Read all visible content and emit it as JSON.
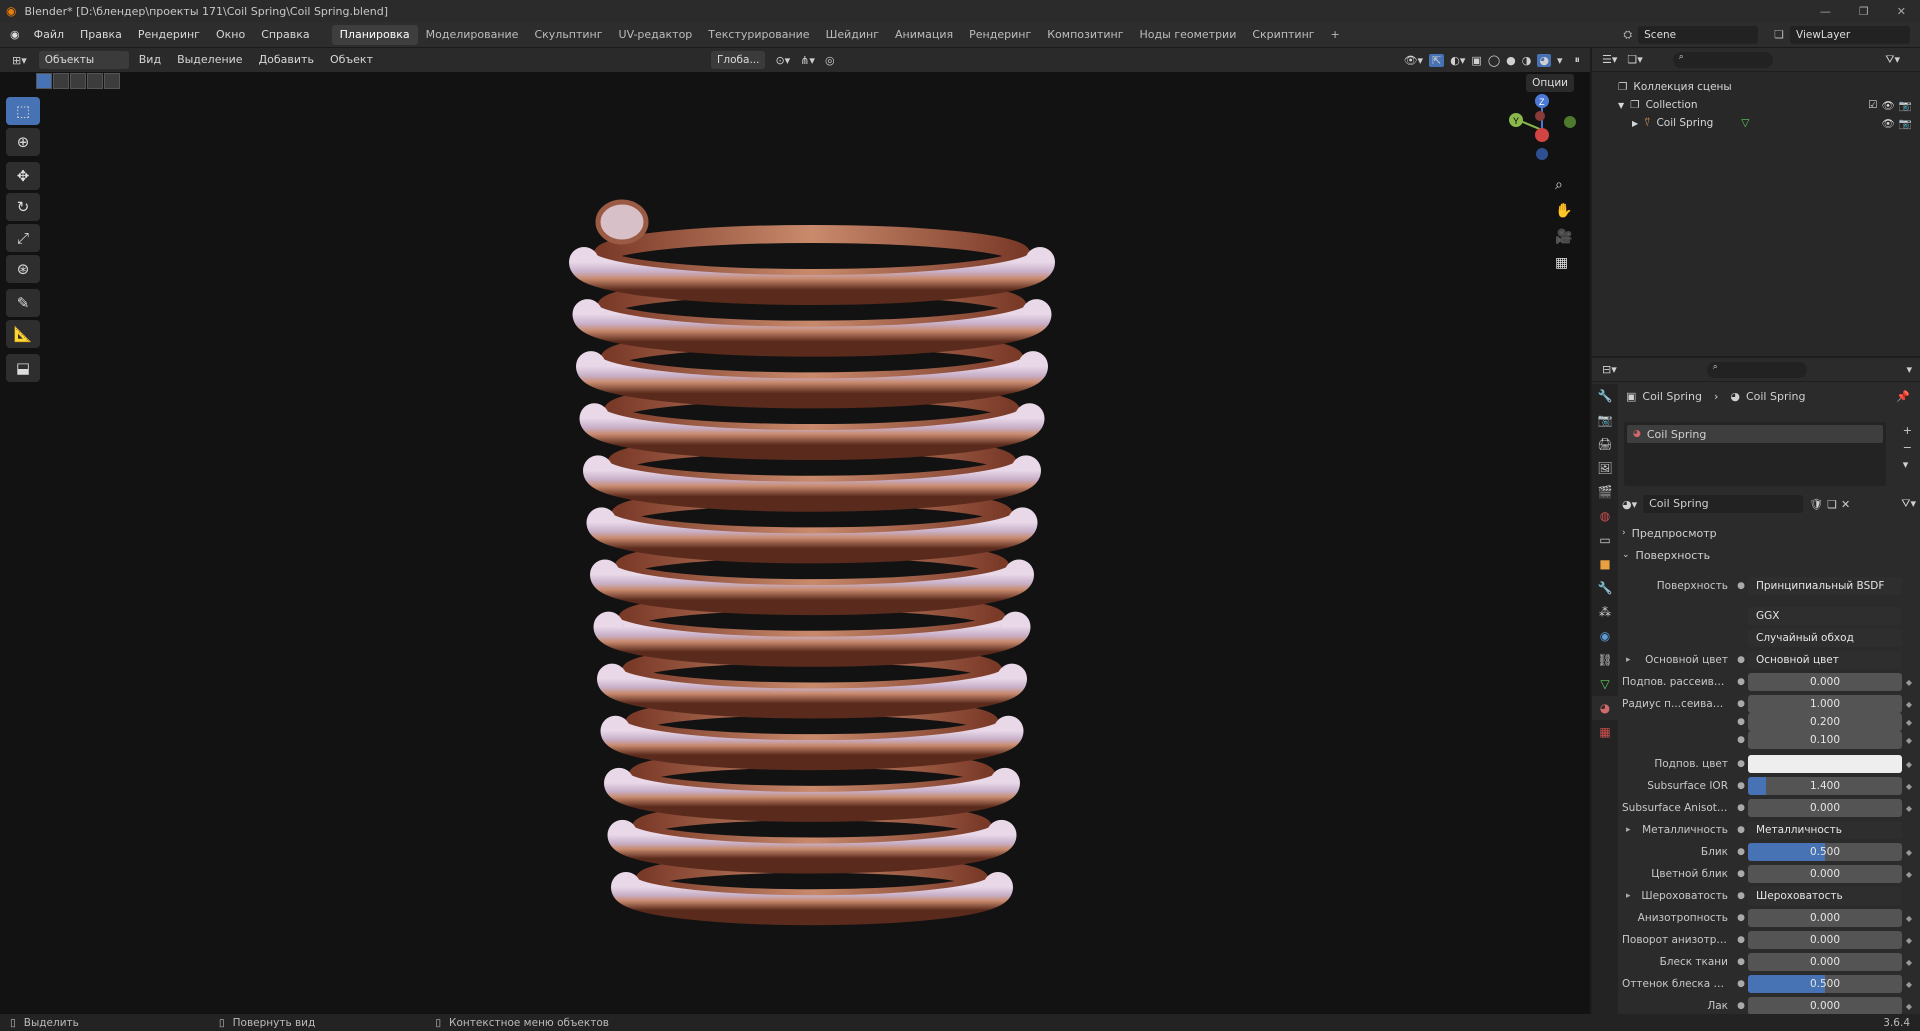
{
  "titlebar": {
    "title": "Blender* [D:\\блендер\\проекты 171\\Coil Spring\\Coil Spring.blend]"
  },
  "menu": [
    "Файл",
    "Правка",
    "Рендеринг",
    "Окно",
    "Справка"
  ],
  "workspaces": [
    "Планировка",
    "Моделирование",
    "Скульптинг",
    "UV-редактор",
    "Текстурирование",
    "Шейдинг",
    "Анимация",
    "Рендеринг",
    "Композитинг",
    "Ноды геометрии",
    "Скриптинг"
  ],
  "active_workspace": "Планировка",
  "scene": {
    "name": "Scene",
    "viewlayer": "ViewLayer"
  },
  "viewport_header": {
    "mode": "Объекты",
    "menus": [
      "Вид",
      "Выделение",
      "Добавить",
      "Объект"
    ],
    "orientation": "Глоба...",
    "options": "Опции"
  },
  "outliner": {
    "scene_collection": "Коллекция сцены",
    "collection": "Collection",
    "object": "Coil Spring"
  },
  "properties": {
    "breadcrumb_object": "Coil Spring",
    "breadcrumb_material": "Coil Spring",
    "slot": "Coil Spring",
    "material_name": "Coil Spring",
    "panel_preview": "Предпросмотр",
    "panel_surface": "Поверхность",
    "rows": [
      {
        "label": "Поверхность",
        "value": "Принципиальный BSDF",
        "type": "link"
      },
      {
        "label": "",
        "value": "GGX",
        "type": "dropdown"
      },
      {
        "label": "",
        "value": "Случайный обход",
        "type": "dropdown"
      },
      {
        "label": "Основной цвет",
        "value": "Основной цвет",
        "type": "link"
      },
      {
        "label": "Подпов. рассеива...",
        "value": "0.000",
        "type": "num",
        "fill": 0
      },
      {
        "label": "Радиус п...сеивания",
        "value": "1.000",
        "type": "num",
        "fill": 0
      },
      {
        "label": "",
        "value": "0.200",
        "type": "num",
        "fill": 0
      },
      {
        "label": "",
        "value": "0.100",
        "type": "num",
        "fill": 0
      },
      {
        "label": "Подпов. цвет",
        "value": "",
        "type": "color"
      },
      {
        "label": "Subsurface IOR",
        "value": "1.400",
        "type": "num",
        "fill": 0.12
      },
      {
        "label": "Subsurface Anisotr...",
        "value": "0.000",
        "type": "num",
        "fill": 0
      },
      {
        "label": "Металличность",
        "value": "Металличность",
        "type": "link"
      },
      {
        "label": "Блик",
        "value": "0.500",
        "type": "num",
        "fill": 0.5
      },
      {
        "label": "Цветной блик",
        "value": "0.000",
        "type": "num",
        "fill": 0
      },
      {
        "label": "Шероховатость",
        "value": "Шероховатость",
        "type": "link"
      },
      {
        "label": "Анизотропность",
        "value": "0.000",
        "type": "num",
        "fill": 0
      },
      {
        "label": "Поворот анизотро...",
        "value": "0.000",
        "type": "num",
        "fill": 0
      },
      {
        "label": "Блеск ткани",
        "value": "0.000",
        "type": "num",
        "fill": 0
      },
      {
        "label": "Оттенок блеска тк...",
        "value": "0.500",
        "type": "num",
        "fill": 0.5
      },
      {
        "label": "Лак",
        "value": "0.000",
        "type": "num",
        "fill": 0
      }
    ]
  },
  "status": {
    "left": "Выделить",
    "middle": "Повернуть вид",
    "right": "Контекстное меню объектов",
    "version": "3.6.4"
  },
  "colors": {
    "accent": "#4772b3",
    "copper": "#b36a4a"
  }
}
